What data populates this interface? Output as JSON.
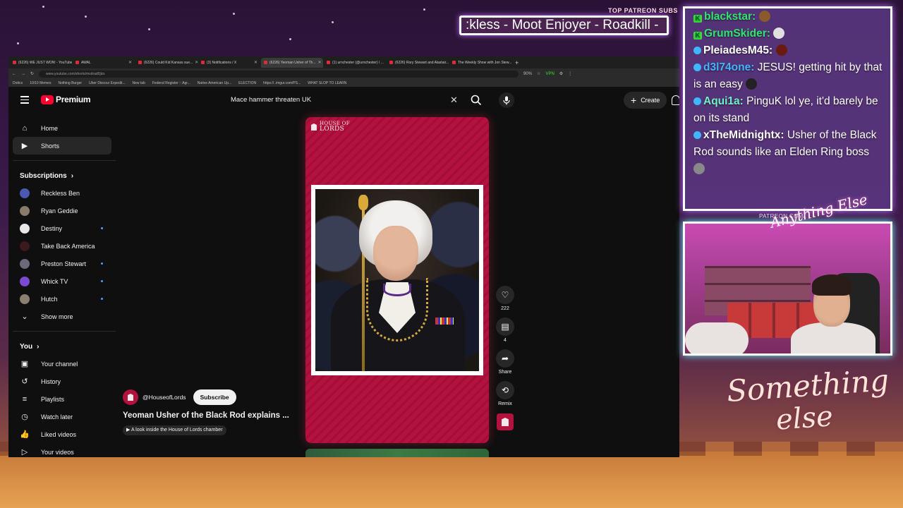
{
  "overlay": {
    "top_patreon_label": "TOP PATREON SUBS",
    "ticker_text": ":kless - Moot Enjoyer - Roadkill - ",
    "cam_label": "PATREON.COM/",
    "cam_signature": "Anything Else",
    "brand_line1": "Something",
    "brand_line2": "else"
  },
  "chat": [
    {
      "user": "blackstar:",
      "message": "",
      "badge": "kick",
      "color": "#2ee66b"
    },
    {
      "user": "GrumSkider:",
      "message": "",
      "badge": "kick",
      "color": "#2ee66b"
    },
    {
      "user": "PleiadesM45:",
      "message": "",
      "badge": "sub",
      "color": "#ffffff"
    },
    {
      "user": "d3l74one:",
      "message": "JESUS! getting hit by that is an easy",
      "badge": "sub",
      "color": "#3fb6ff"
    },
    {
      "user": "Aqui1a:",
      "message": "PinguK lol ye, it'd barely be on its stand",
      "badge": "sub",
      "color": "#6ef0c8"
    },
    {
      "user": "xTheMidnightx:",
      "message": "Usher of the Black Rod sounds like an Elden Ring boss",
      "badge": "sub",
      "color": "#ffffff"
    }
  ],
  "browser": {
    "tabs": [
      "(6226) WE JUST WON! - YouTube",
      "AWAL",
      "(6226) Could Kid Kansas sue...",
      "(3) Notifications / X",
      "(6226) Yeoman Usher of Th...",
      "(1) urnchester (@urnchester) / ...",
      "(6226) Rory Stewart and Alastair...",
      "The Weekly Show with Jon Stew..."
    ],
    "active_tab_index": 4,
    "url": "www.youtube.com/shorts/mvdrad0jlzs",
    "zoom": "90%",
    "vpn_label": "VPN",
    "bookmarks": [
      "Dottcs",
      "10/10 Memes",
      "Nothing Burger",
      "Uber Discour Expedit...",
      "New tab",
      "Federal Register :: Agr...",
      "Native American Up...",
      "ELECTION",
      "https://..imgur.com/PS...",
      "WHAT SLOP TO LEARN"
    ]
  },
  "youtube": {
    "logo_text": "Premium",
    "search_value": "Mace hammer threaten UK",
    "create_label": "Create",
    "nav": [
      {
        "label": "Home",
        "icon": "home-icon",
        "glyph": "⌂",
        "active": false
      },
      {
        "label": "Shorts",
        "icon": "shorts-icon",
        "glyph": "▶",
        "active": true
      }
    ],
    "subscriptions_title": "Subscriptions",
    "subscriptions": [
      {
        "name": "Reckless Ben",
        "color": "#4a5ab0",
        "dot": false
      },
      {
        "name": "Ryan Geddie",
        "color": "#8a7a6a",
        "dot": false
      },
      {
        "name": "Destiny",
        "color": "#e8e8e8",
        "dot": true
      },
      {
        "name": "Take Back America",
        "color": "#3a1a1a",
        "dot": false
      },
      {
        "name": "Preston Stewart",
        "color": "#6a6a7a",
        "dot": true
      },
      {
        "name": "Whick TV",
        "color": "#7a4ad0",
        "dot": true
      },
      {
        "name": "Hutch",
        "color": "#8a8070",
        "dot": true
      }
    ],
    "show_more": "Show more",
    "you_title": "You",
    "you_items": [
      {
        "label": "Your channel",
        "icon": "your-channel-icon",
        "glyph": "▣"
      },
      {
        "label": "History",
        "icon": "history-icon",
        "glyph": "↺"
      },
      {
        "label": "Playlists",
        "icon": "playlists-icon",
        "glyph": "≡"
      },
      {
        "label": "Watch later",
        "icon": "watch-later-icon",
        "glyph": "◷"
      },
      {
        "label": "Liked videos",
        "icon": "liked-videos-icon",
        "glyph": "👍"
      },
      {
        "label": "Your videos",
        "icon": "your-videos-icon",
        "glyph": "▷"
      }
    ],
    "short": {
      "brand_line1": "HOUSE OF",
      "brand_line2": "LORDS",
      "channel": "@HouseofLords",
      "subscribe_label": "Subscribe",
      "title": "Yeoman Usher of the Black Rod explains ...",
      "link_text": "A look inside the House of Lords chamber",
      "like_count": "222",
      "comment_count": "4",
      "share_label": "Share",
      "remix_label": "Remix"
    }
  }
}
